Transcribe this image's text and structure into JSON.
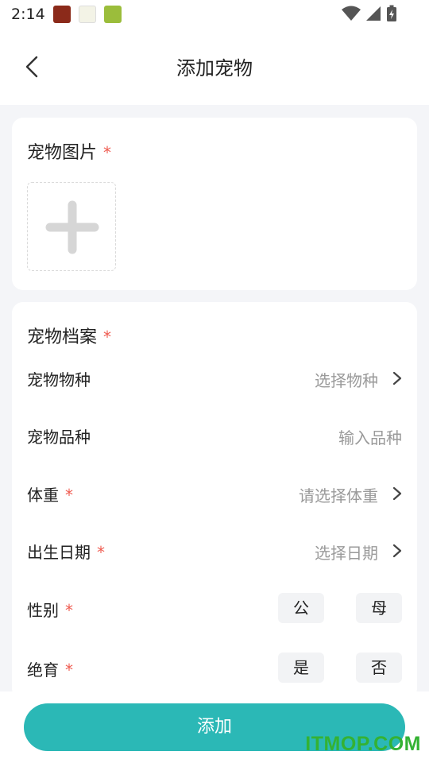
{
  "status_bar": {
    "time": "2:14",
    "app_icons": [
      "app-icon-1",
      "app-icon-2",
      "app-icon-3"
    ]
  },
  "header": {
    "title": "添加宠物",
    "back_icon": "chevron-left-icon"
  },
  "photo_section": {
    "title": "宠物图片",
    "required_mark": "*",
    "upload_icon": "plus-icon"
  },
  "profile_section": {
    "title": "宠物档案",
    "required_mark": "*",
    "fields": {
      "species": {
        "label": "宠物物种",
        "placeholder": "选择物种"
      },
      "breed": {
        "label": "宠物品种",
        "placeholder": "输入品种"
      },
      "weight": {
        "label": "体重",
        "required_mark": "*",
        "placeholder": "请选择体重"
      },
      "birthdate": {
        "label": "出生日期",
        "required_mark": "*",
        "placeholder": "选择日期"
      },
      "gender": {
        "label": "性别",
        "required_mark": "*",
        "options": [
          "公",
          "母"
        ]
      },
      "neutered": {
        "label": "绝育",
        "required_mark": "*",
        "options": [
          "是",
          "否"
        ]
      }
    }
  },
  "footer": {
    "add_label": "添加",
    "watermark": "ITMOP.COM"
  },
  "colors": {
    "accent": "#2bb8b6",
    "required": "#ef5b50",
    "placeholder": "#9a9a9a",
    "background": "#f4f5f8",
    "watermark": "#34b233"
  }
}
